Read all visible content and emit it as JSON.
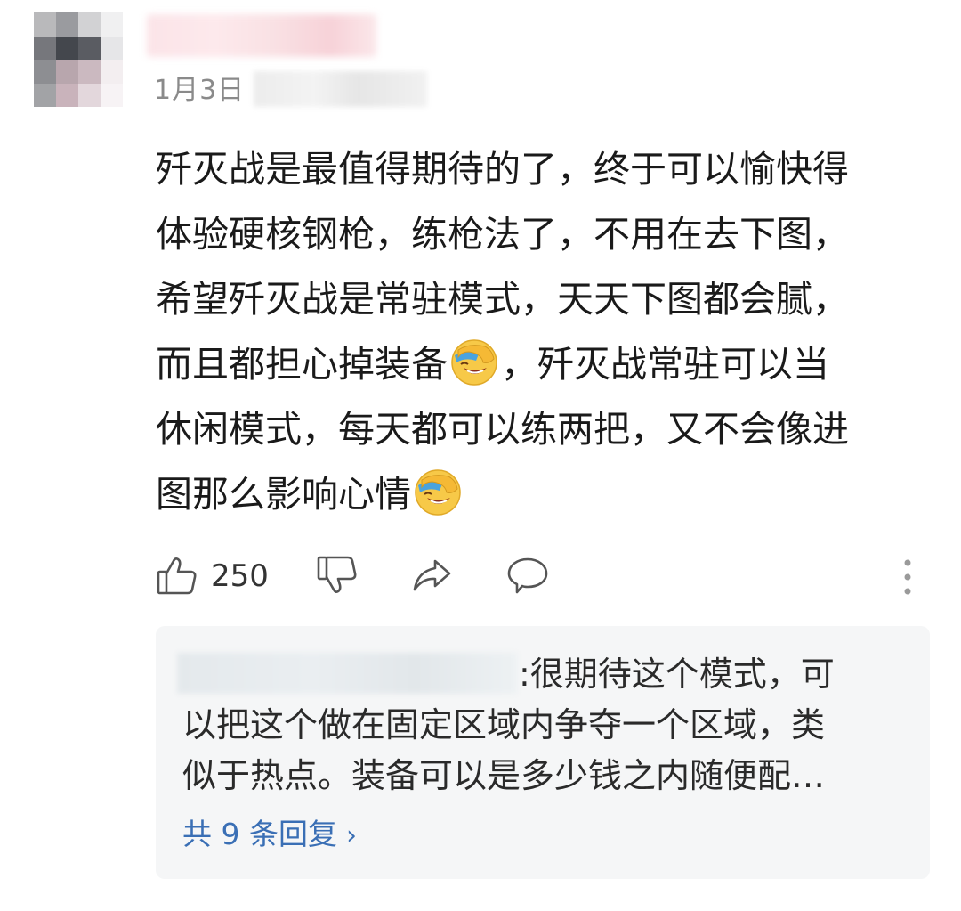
{
  "comment": {
    "date": "1月3日",
    "text_lines": [
      "歼灭战是最值得期待的了，终于可以愉快得",
      "体验硬核钢枪，练枪法了，不用在去下图，",
      "希望歼灭战是常驻模式，天天下图都会腻，",
      "而且都担心掉装备",
      "，歼灭战常驻可以当",
      "休闲模式，每天都可以练两把，又不会像进",
      "图那么影响心情"
    ],
    "emoji_icon": "facepalm-laugh-emoji"
  },
  "actions": {
    "like_icon": "thumbs-up-icon",
    "like_count": "250",
    "dislike_icon": "thumbs-down-icon",
    "share_icon": "share-icon",
    "reply_icon": "comment-bubble-icon",
    "more_icon": "vertical-dots-icon"
  },
  "replies": {
    "preview_lines": [
      ":很期待这个模式，可",
      "以把这个做在固定区域内争夺一个区域，类",
      "似于热点。装备可以是多少钱之内随便配…"
    ],
    "more_label": "共 9 条回复",
    "more_chevron": "›"
  },
  "colors": {
    "link_blue": "#3a6fb5",
    "date_gray": "#8a8a8a",
    "reply_bg": "#f5f6f7"
  }
}
